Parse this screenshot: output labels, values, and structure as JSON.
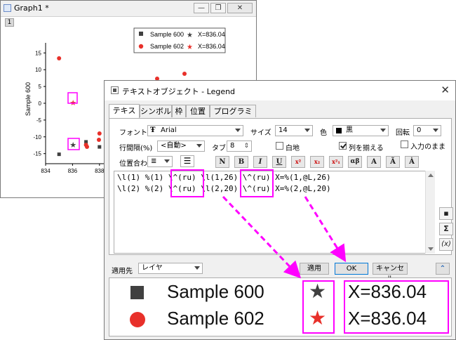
{
  "graph_window": {
    "title": "Graph1 *",
    "layer_tab": "1",
    "controls": {
      "minimize": "—",
      "restore": "❐",
      "close": "✕"
    },
    "ylabel": "Sample 600",
    "yticks": [
      "15",
      "10",
      "5",
      "0",
      "-5",
      "-10",
      "-15"
    ],
    "xticks": [
      "834",
      "836",
      "838"
    ],
    "legend": [
      {
        "marker": "square",
        "label": "Sample 600",
        "star_text": "X=836.04",
        "color": "#404040"
      },
      {
        "marker": "circle",
        "label": "Sample 602",
        "star_text": "X=836.04",
        "color": "#e8302a"
      }
    ]
  },
  "dialog": {
    "title": "テキストオブジェクト - Legend",
    "close": "✕",
    "tabs": [
      "テキスト",
      "シンボル",
      "枠",
      "位置",
      "プログラミング"
    ],
    "font_label": "フォント",
    "font_value": "Arial",
    "size_label": "サイズ",
    "size_value": "14",
    "color_label": "色",
    "color_value": "黒",
    "rotate_label": "回転",
    "rotate_value": "0",
    "linespacing_label": "行間隔(%)",
    "linespacing_value": "<自動>",
    "tab_label": "タブ",
    "tab_value": "8",
    "white_bg_label": "白地",
    "align_columns_label": "列を揃える",
    "as_input_label": "入力のまま",
    "alignment_label": "位置合わ",
    "format_buttons": [
      "N",
      "B",
      "I",
      "U",
      "x²",
      "x₂",
      "x²₁",
      "αβ",
      "A",
      "Ã",
      "Ȧ"
    ],
    "editor_lines": [
      "\\l(1) %(1) \\^(ru) \\l(1,26) \\^(ru) X=%(1,@L,26)",
      "\\l(2) %(2) \\^(ru) \\l(2,20) \\^(ru) X=%(2,@L,20)"
    ],
    "side_buttons": [
      "▪",
      "Σ",
      "(x)"
    ],
    "apply_to_label": "適用先",
    "apply_to_value": "レイヤ",
    "apply_button": "適用",
    "ok_button": "OK",
    "cancel_button": "キャンセル",
    "collapse_button": "⌃",
    "preview": [
      {
        "marker": "square",
        "label": "Sample 600",
        "star": "★",
        "text": "X=836.04",
        "color": "#404040"
      },
      {
        "marker": "circle",
        "label": "Sample 602",
        "star": "★",
        "text": "X=836.04",
        "color": "#e8302a"
      }
    ]
  },
  "chart_data": {
    "type": "scatter",
    "title": "",
    "xlabel": "",
    "ylabel": "Sample 600",
    "xlim": [
      834,
      839
    ],
    "ylim": [
      -18,
      18
    ],
    "x_ticks": [
      834,
      836,
      838
    ],
    "y_ticks": [
      15,
      10,
      5,
      0,
      -5,
      -10,
      -15
    ],
    "series": [
      {
        "name": "Sample 600",
        "marker": "square",
        "color": "#404040",
        "x": [
          835,
          836.04,
          837,
          838
        ],
        "y": [
          -15.2,
          -12.4,
          -11.5,
          -13
        ]
      },
      {
        "name": "Sample 602",
        "marker": "circle",
        "color": "#e8302a",
        "x": [
          835,
          836.04,
          837,
          838
        ],
        "y": [
          13.4,
          0.2,
          -12.4,
          -9
        ]
      }
    ],
    "star_markers": [
      {
        "x": 836.04,
        "y": 0.2,
        "color": "#e8302a"
      },
      {
        "x": 836.04,
        "y": -12.4,
        "color": "#404040"
      }
    ],
    "extra_points_behind_dialog": [
      {
        "color": "#e8302a",
        "desc": "partially visible"
      }
    ]
  }
}
